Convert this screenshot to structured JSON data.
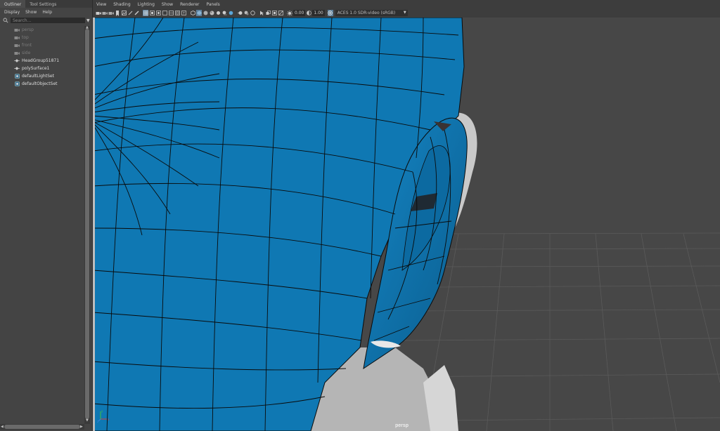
{
  "outliner": {
    "tabs": [
      {
        "label": "Outliner",
        "active": true
      },
      {
        "label": "Tool Settings",
        "active": false
      }
    ],
    "menu": [
      "Display",
      "Show",
      "Help"
    ],
    "search": {
      "placeholder": "Search...",
      "value": ""
    },
    "items": [
      {
        "label": "persp",
        "icon": "camera-icon",
        "dim": true
      },
      {
        "label": "top",
        "icon": "camera-icon",
        "dim": true
      },
      {
        "label": "front",
        "icon": "camera-icon",
        "dim": true
      },
      {
        "label": "side",
        "icon": "camera-icon",
        "dim": true
      },
      {
        "label": "HeadGroup51871",
        "icon": "group-icon",
        "dim": false
      },
      {
        "label": "polySurface1",
        "icon": "group-icon",
        "dim": false
      },
      {
        "label": "defaultLightSet",
        "icon": "set-icon",
        "dim": false
      },
      {
        "label": "defaultObjectSet",
        "icon": "set-icon",
        "dim": false
      }
    ]
  },
  "viewport": {
    "menu": [
      "View",
      "Shading",
      "Lighting",
      "Show",
      "Renderer",
      "Panels"
    ],
    "toolbar": {
      "exposure": "0.00",
      "gamma": "1.00",
      "colorspace": "ACES 1.0 SDR-video (sRGB)"
    },
    "camera_label": "persp"
  },
  "colors": {
    "mesh_blue": "#0f78b3",
    "panel_bg": "#444444",
    "grid_line": "#5a5a5a"
  }
}
